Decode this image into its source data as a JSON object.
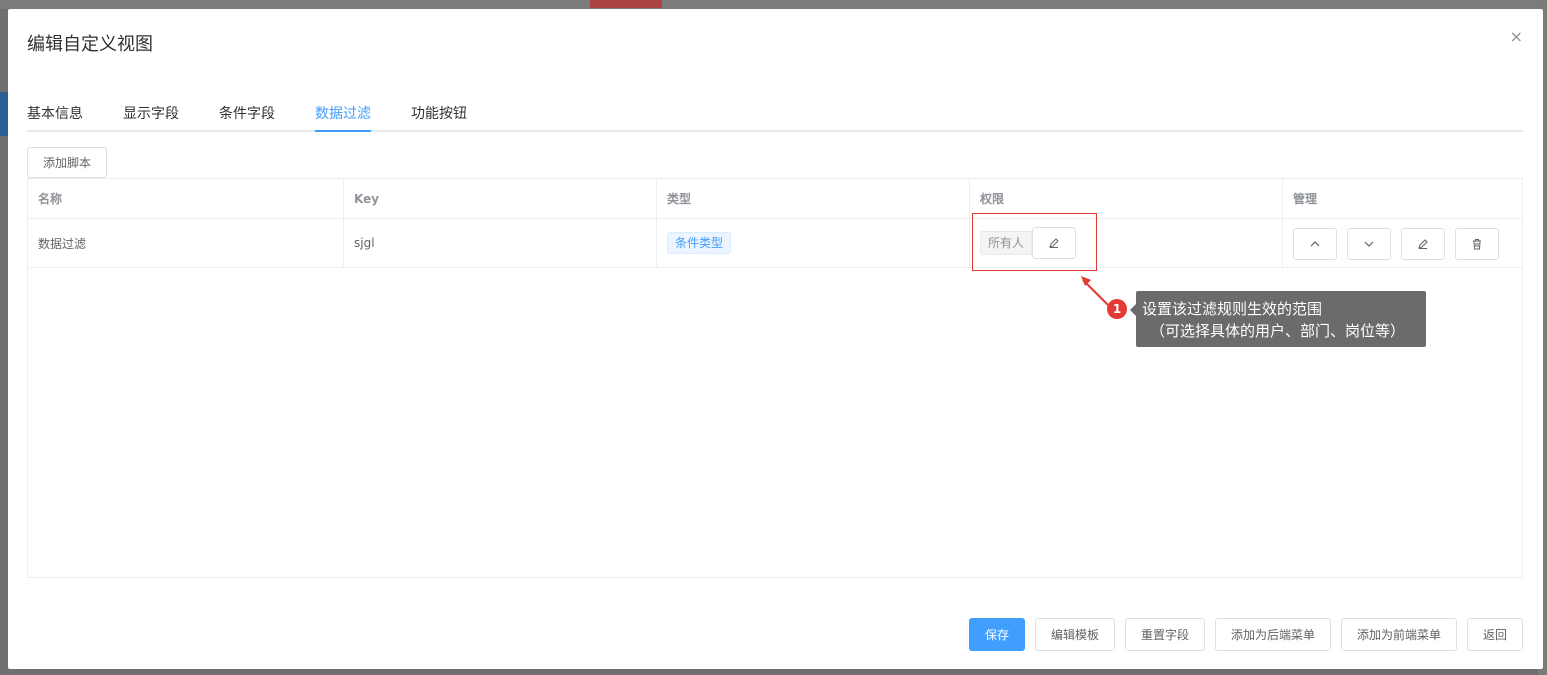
{
  "dialog": {
    "title": "编辑自定义视图",
    "close_glyph": "×"
  },
  "tabs": [
    {
      "label": "基本信息",
      "active": false
    },
    {
      "label": "显示字段",
      "active": false
    },
    {
      "label": "条件字段",
      "active": false
    },
    {
      "label": "数据过滤",
      "active": true
    },
    {
      "label": "功能按钮",
      "active": false
    }
  ],
  "toolbar": {
    "add_script_label": "添加脚本"
  },
  "table": {
    "columns": [
      "名称",
      "Key",
      "类型",
      "权限",
      "管理"
    ],
    "rows": [
      {
        "name": "数据过滤",
        "key": "sjgl",
        "type": "条件类型",
        "permission": "所有人"
      }
    ]
  },
  "annotation": {
    "badge": "1",
    "line1": "设置该过滤规则生效的范围",
    "line2": "（可选择具体的用户、部门、岗位等）"
  },
  "footer": {
    "save": "保存",
    "edit_template": "编辑模板",
    "reset_fields": "重置字段",
    "add_backend_menu": "添加为后端菜单",
    "add_frontend_menu": "添加为前端菜单",
    "back": "返回"
  },
  "colors": {
    "primary": "#409eff",
    "annotation_red": "#e53935",
    "annotation_bg": "#6b6b6b"
  }
}
